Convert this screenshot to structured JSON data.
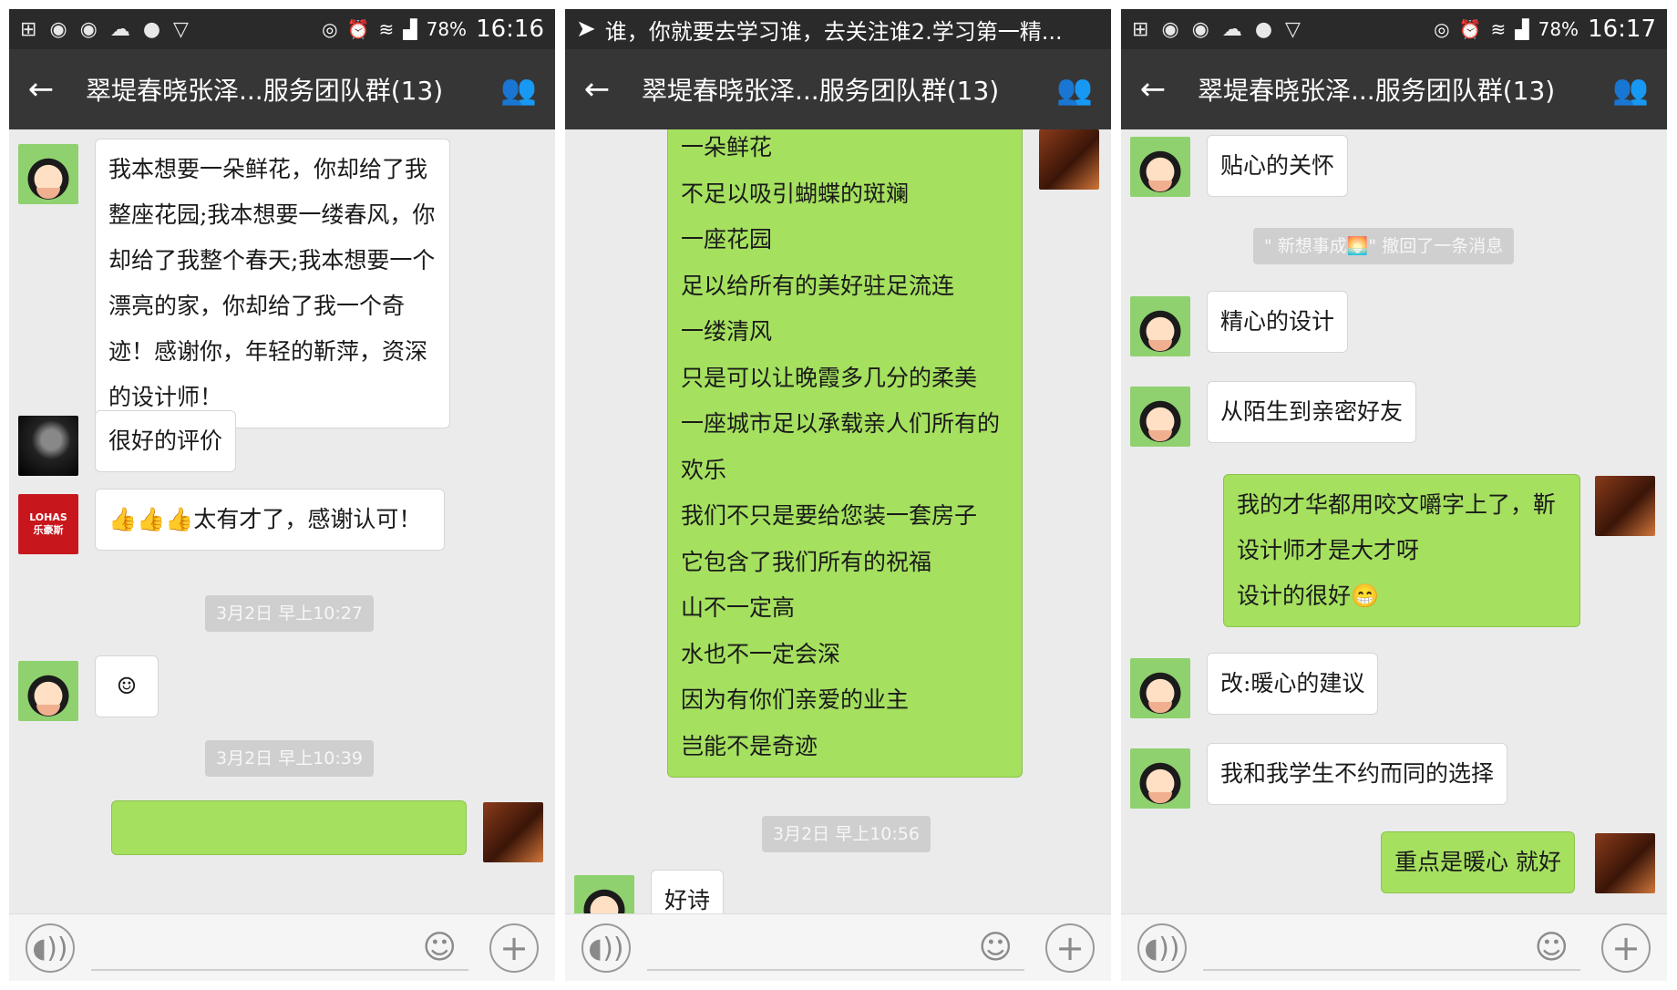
{
  "colors": {
    "statusbar": "#2a2a2a",
    "titlebar": "#363636",
    "chat_bg": "#ebebeb",
    "incoming": "#ffffff",
    "outgoing": "#a5e05f"
  },
  "screens": [
    {
      "status": {
        "battery": "78%",
        "time": "16:16"
      },
      "title": "翠堤春晓张泽...服务团队群(13)",
      "messages": {
        "m1": [
          "我本想要一朵鲜花，你却给了我",
          "整座花园;我本想要一缕春风，你",
          "却给了我整个春天;我本想要一个",
          "漂亮的家，你却给了我一个奇",
          "迹！感谢你，年轻的靳萍，资深",
          "的设计师！"
        ],
        "m2": "很好的评价",
        "m3": "👍👍👍太有才了，感谢认可！",
        "stamp1": "3月2日 早上10:27",
        "m4": "☺",
        "stamp2": "3月2日 早上10:39"
      },
      "lohas_avatar": {
        "line1": "LOHAS",
        "line2": "乐豪斯"
      }
    },
    {
      "notification": "谁，你就要去学习谁，去关注谁2.学习第一精...",
      "title": "翠堤春晓张泽...服务团队群(13)",
      "poem": [
        "一朵鲜花",
        "不足以吸引蝴蝶的斑斓",
        "一座花园",
        "足以给所有的美好驻足流连",
        "一缕清风",
        "只是可以让晚霞多几分的柔美",
        "一座城市足以承载亲人们所有的",
        "欢乐",
        "我们不只是要给您装一套房子",
        "它包含了我们所有的祝福",
        "山不一定高",
        "水也不一定会深",
        "因为有你们亲爱的业主",
        "岂能不是奇迹"
      ],
      "stamp": "3月2日 早上10:56",
      "partial": "好诗"
    },
    {
      "status": {
        "battery": "78%",
        "time": "16:17"
      },
      "title": "翠堤春晓张泽...服务团队群(13)",
      "m1": "贴心的关怀",
      "recall": "\" 新想事成🌅\" 撤回了一条消息",
      "m2": "精心的设计",
      "m3": "从陌生到亲密好友",
      "m4": [
        "我的才华都用咬文嚼字上了，靳",
        "设计师才是大才呀",
        "设计的很好😁"
      ],
      "m5": "改:暖心的建议",
      "m6": "我和我学生不约而同的选择",
      "m7": "重点是暖心 就好"
    }
  ],
  "icons": {
    "back": "arrow-left",
    "group": "group-people",
    "voice": "voice",
    "emoji": "smiley",
    "plus": "plus"
  }
}
